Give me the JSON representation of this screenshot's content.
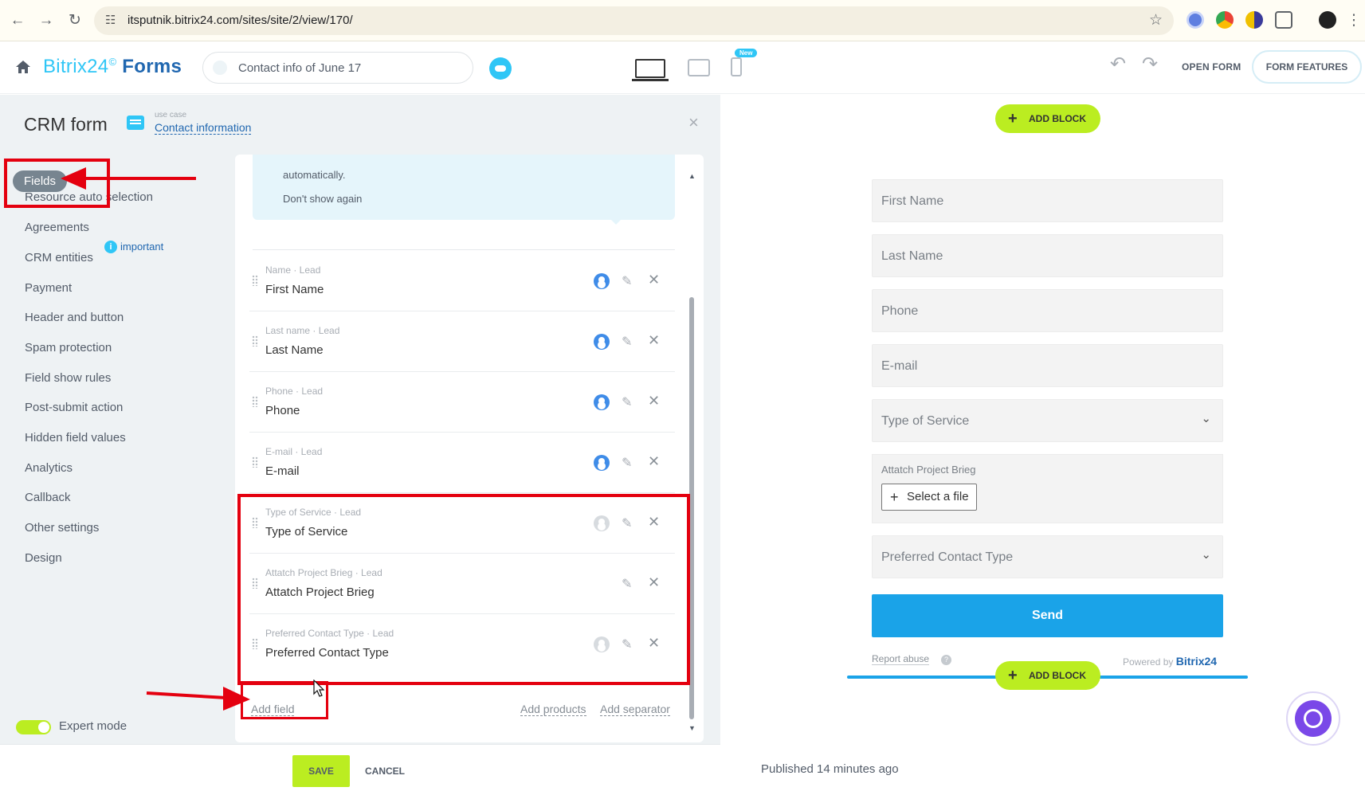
{
  "browser": {
    "url": "itsputnik.bitrix24.com/sites/site/2/view/170/"
  },
  "header": {
    "brand": "Bitrix24",
    "brand_mark": "©",
    "brand_product": "Forms",
    "doc_title": "Contact info of June 17",
    "new_badge": "New",
    "open_form": "OPEN FORM",
    "form_features": "FORM FEATURES"
  },
  "panel": {
    "title": "CRM form",
    "use_case_label": "use case",
    "use_case_value": "Contact information",
    "close_glyph": "×",
    "menu": [
      {
        "label": "Fields",
        "active": true
      },
      {
        "label": "Resource auto selection"
      },
      {
        "label": "Agreements",
        "badge": "important"
      },
      {
        "label": "CRM entities"
      },
      {
        "label": "Payment"
      },
      {
        "label": "Header and button"
      },
      {
        "label": "Spam protection"
      },
      {
        "label": "Field show rules"
      },
      {
        "label": "Post-submit action"
      },
      {
        "label": "Hidden field values"
      },
      {
        "label": "Analytics"
      },
      {
        "label": "Callback"
      },
      {
        "label": "Other settings"
      },
      {
        "label": "Design"
      }
    ],
    "expert_mode": "Expert mode",
    "hint": {
      "text": "automatically.",
      "dont_show": "Don't show again"
    },
    "fields": [
      {
        "sub": "Name · Lead",
        "label": "First Name",
        "crm": true
      },
      {
        "sub": "Last name · Lead",
        "label": "Last Name",
        "crm": true
      },
      {
        "sub": "Phone · Lead",
        "label": "Phone",
        "crm": true
      },
      {
        "sub": "E-mail · Lead",
        "label": "E-mail",
        "crm": true
      },
      {
        "sub": "Type of Service · Lead",
        "label": "Type of Service",
        "crm": false
      },
      {
        "sub": "Attatch Project Brieg · Lead",
        "label": "Attatch Project Brieg",
        "crm": null
      },
      {
        "sub": "Preferred Contact Type · Lead",
        "label": "Preferred Contact Type",
        "crm": false
      }
    ],
    "add_field": "Add field",
    "add_products": "Add products",
    "add_separator": "Add separator",
    "save": "SAVE",
    "cancel": "CANCEL"
  },
  "preview": {
    "add_block": "ADD BLOCK",
    "inputs": [
      "First Name",
      "Last Name",
      "Phone",
      "E-mail"
    ],
    "select_service": "Type of Service",
    "file_label": "Attatch Project Brieg",
    "file_button": "Select a file",
    "select_contact": "Preferred Contact Type",
    "send": "Send",
    "report_abuse": "Report abuse",
    "powered_by": "Powered by",
    "powered_brand": "Bitrix24",
    "published": "Published 14 minutes ago"
  },
  "colors": {
    "accent_green": "#bbed21",
    "accent_blue": "#1aa3e8",
    "annotation_red": "#e4000f"
  }
}
